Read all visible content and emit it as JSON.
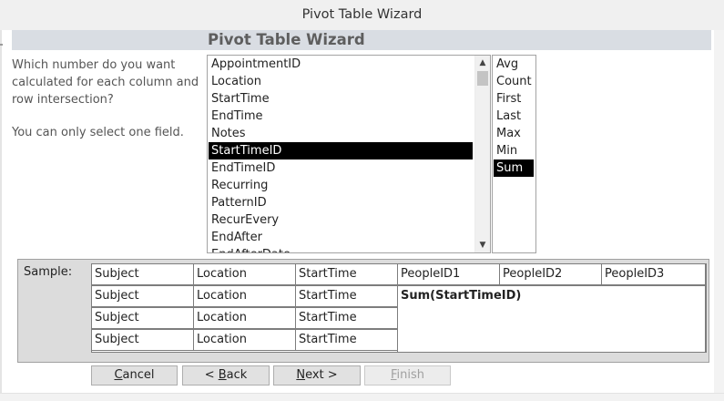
{
  "window": {
    "title": "Pivot Table Wizard"
  },
  "header": {
    "title": "Pivot Table Wizard"
  },
  "instructions": {
    "question": "Which number do you want calculated for each column and row intersection?",
    "note": "You can only select one field."
  },
  "fields": {
    "items": [
      "AppointmentID",
      "Location",
      "StartTime",
      "EndTime",
      "Notes",
      "StartTimeID",
      "EndTimeID",
      "Recurring",
      "PatternID",
      "RecurEvery",
      "EndAfter",
      "EndAfterDate"
    ],
    "selected": "StartTimeID"
  },
  "functions": {
    "items": [
      "Avg",
      "Count",
      "First",
      "Last",
      "Max",
      "Min",
      "Sum"
    ],
    "selected": "Sum"
  },
  "sample": {
    "label": "Sample:",
    "header_row": [
      "Subject",
      "Location",
      "StartTime",
      "PeopleID1",
      "PeopleID2",
      "PeopleID3"
    ],
    "row_fields": [
      "Subject",
      "Location",
      "StartTime"
    ],
    "value_text": "Sum(StartTimeID)"
  },
  "buttons": {
    "cancel": {
      "pre": "",
      "key": "C",
      "post": "ancel"
    },
    "back": {
      "pre": "< ",
      "key": "B",
      "post": "ack"
    },
    "next": {
      "pre": "",
      "key": "N",
      "post": "ext >"
    },
    "finish": {
      "pre": "",
      "key": "F",
      "post": "inish"
    }
  },
  "icons": {
    "scroll_up": "chevron-up-icon",
    "scroll_down": "chevron-down-icon"
  }
}
